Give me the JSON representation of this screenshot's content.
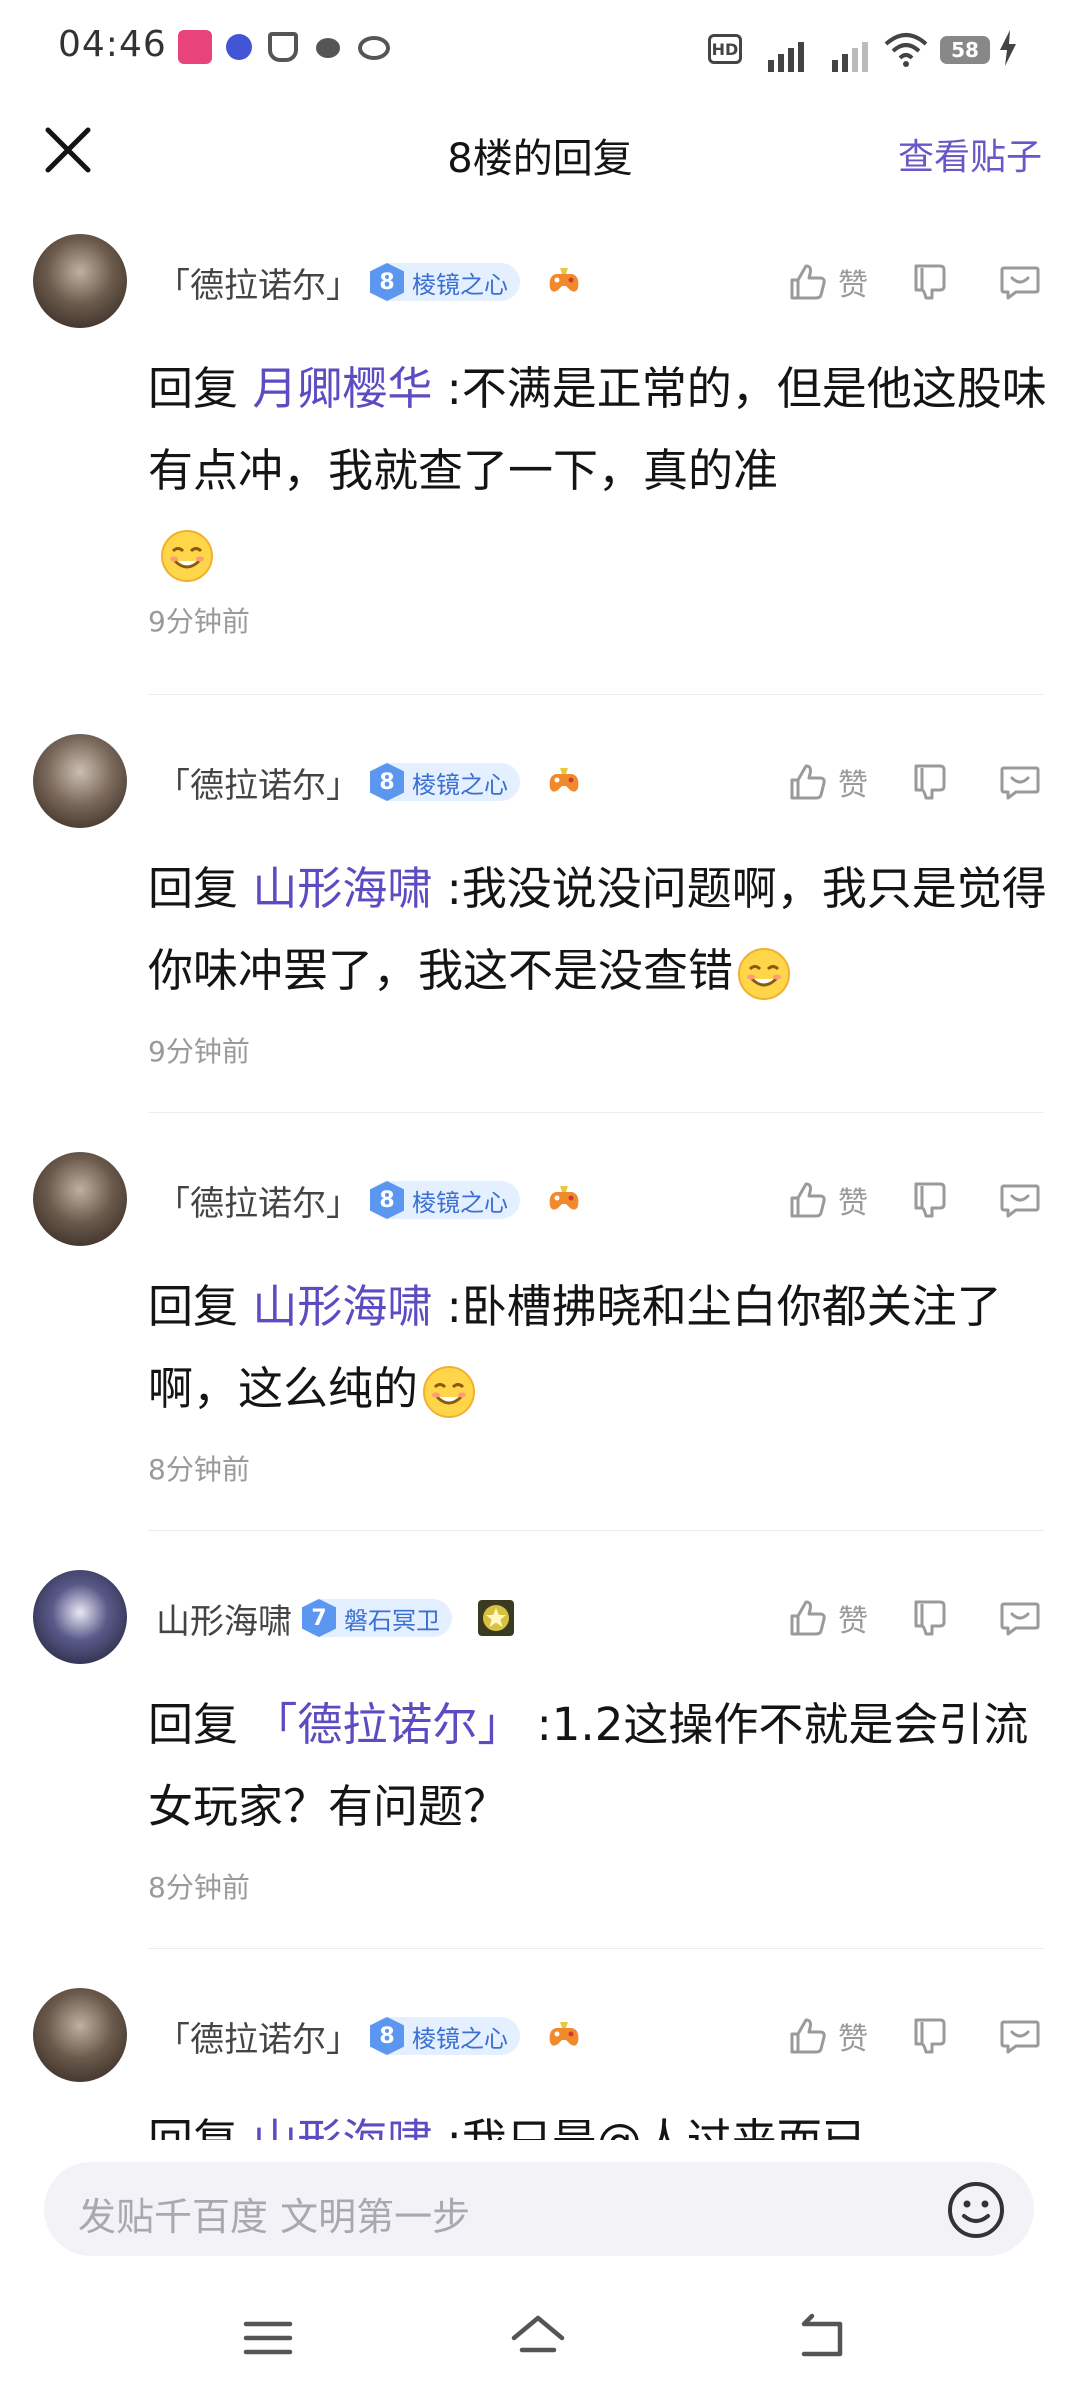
{
  "status_bar": {
    "time": "04:46",
    "battery": "58",
    "hd": "HD"
  },
  "header": {
    "title": "8楼的回复",
    "view_post": "查看贴子"
  },
  "like_label": "赞",
  "comments": [
    {
      "username": "「德拉诺尔」",
      "level": "8",
      "level_title": "棱镜之心",
      "reply_prefix": "回复 ",
      "target": "月卿樱华",
      "text": " :不满是正常的，但是他这股味有点冲，我就查了一下，真的准",
      "time": "9分钟前"
    },
    {
      "username": "「德拉诺尔」",
      "level": "8",
      "level_title": "棱镜之心",
      "reply_prefix": "回复 ",
      "target": "山形海啸",
      "text": " :我没说没问题啊，我只是觉得你味冲罢了，我这不是没查错",
      "time": "9分钟前"
    },
    {
      "username": "「德拉诺尔」",
      "level": "8",
      "level_title": "棱镜之心",
      "reply_prefix": "回复 ",
      "target": "山形海啸",
      "text": " :卧槽拂晓和尘白你都关注了啊，这么纯的",
      "time": "8分钟前"
    },
    {
      "username": "山形海啸",
      "level": "7",
      "level_title": "磐石冥卫",
      "reply_prefix": "回复 ",
      "target": "「德拉诺尔」",
      "text": " :1.2这操作不就是会引流女玩家？有问题？",
      "time": "8分钟前"
    },
    {
      "username": "「德拉诺尔」",
      "level": "8",
      "level_title": "棱镜之心",
      "reply_prefix": "回复 ",
      "target": "山形海啸",
      "text": " :我只是@人过来而已",
      "time": ""
    }
  ],
  "input": {
    "placeholder": "发贴千百度 文明第一步"
  },
  "colors": {
    "accent": "#6a56c7",
    "level_badge": "#5b97f0",
    "muted": "#9a9a9a"
  }
}
